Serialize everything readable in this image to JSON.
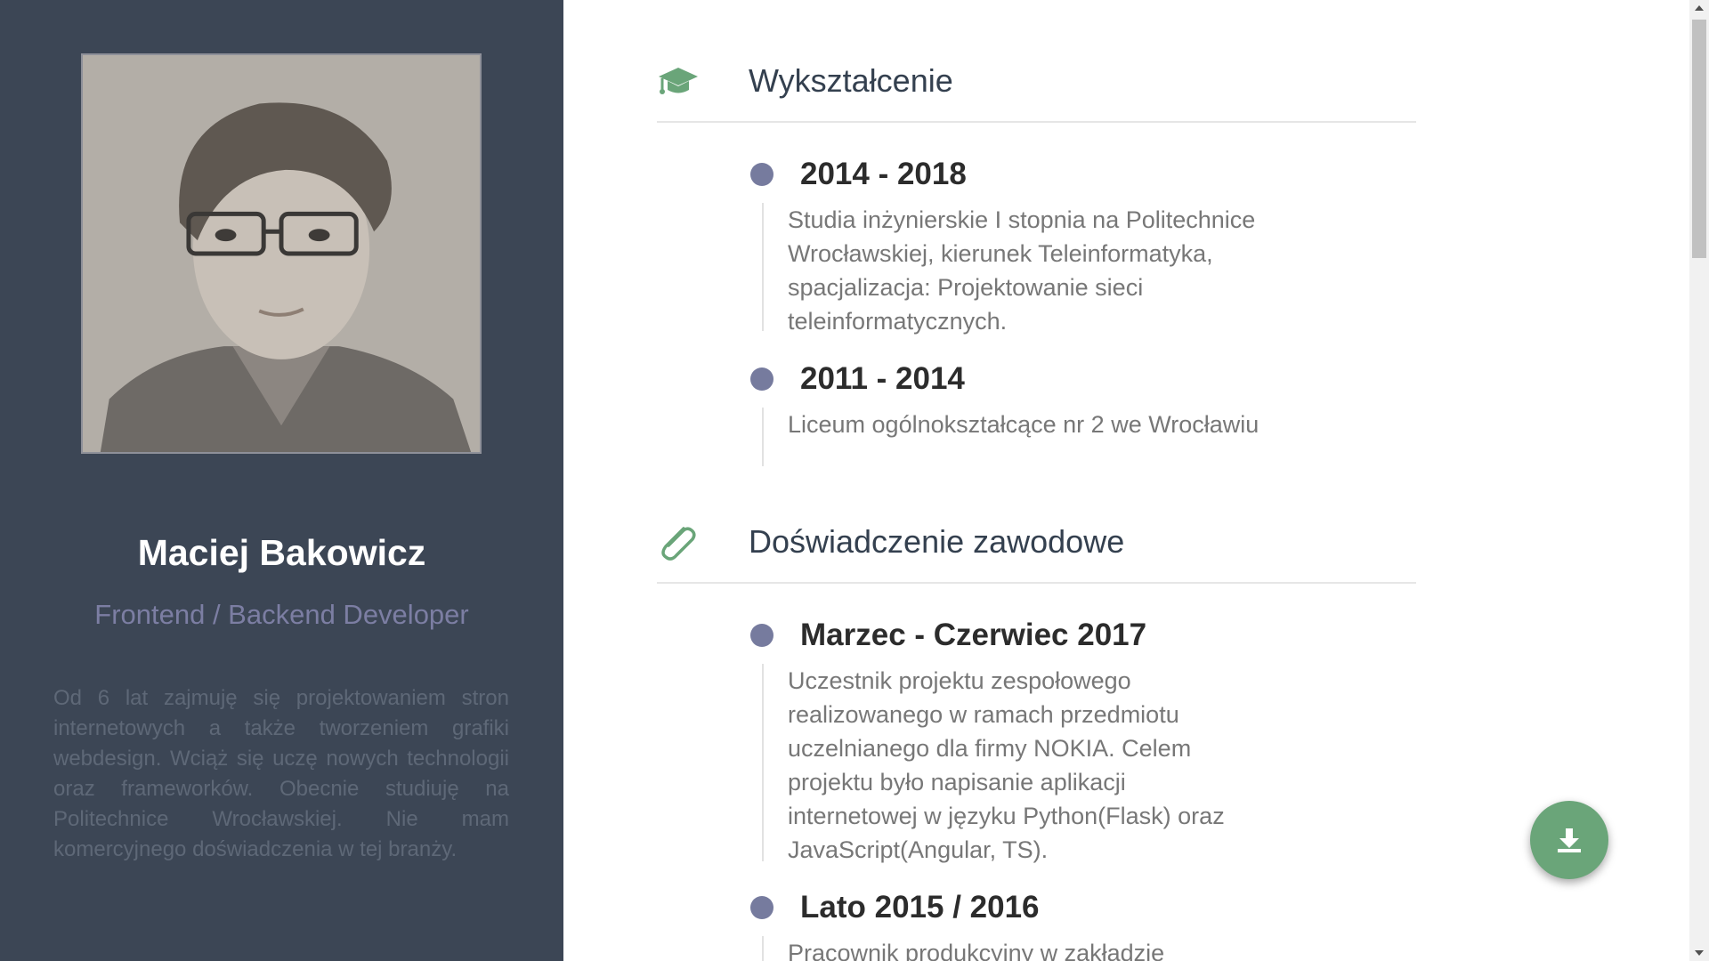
{
  "profile": {
    "name": "Maciej Bakowicz",
    "role": "Frontend / Backend Developer",
    "bio": "Od 6 lat zajmuję się projektowaniem stron internetowych a także tworzeniem grafiki webdesign. Wciąż się uczę nowych technologii oraz frameworków. Obecnie studiuję na Politechnice Wrocławskiej. Nie mam komercyjnego doświadczenia w tej branży."
  },
  "education": {
    "title": "Wykształcenie",
    "icon": "graduation-cap-icon",
    "entries": [
      {
        "date": "2014 - 2018",
        "text": "Studia inżynierskie I stopnia na Politechnice Wrocławskiej, kierunek Teleinformatyka, spacjalizacja: Projektowanie sieci teleinformatycznych."
      },
      {
        "date": "2011 - 2014",
        "text": "Liceum ogólnokształcące nr 2 we Wrocławiu"
      }
    ]
  },
  "experience": {
    "title": "Doświadczenie zawodowe",
    "icon": "paperclip-icon",
    "entries": [
      {
        "date": "Marzec - Czerwiec 2017",
        "text": "Uczestnik projektu zespołowego realizowanego w ramach przedmiotu uczelnianego dla firmy NOKIA. Celem projektu było napisanie aplikacji internetowej w języku Python(Flask) oraz JavaScript(Angular, TS)."
      },
      {
        "date": "Lato 2015 / 2016",
        "text": "Pracownik produkcyjny w zakładzie produkcji"
      }
    ]
  },
  "fab": {
    "icon": "download-icon"
  },
  "colors": {
    "sidebar": "#3c4655",
    "accent": "#6aa579",
    "dot": "#767b9e",
    "role": "#7c7ea3"
  }
}
